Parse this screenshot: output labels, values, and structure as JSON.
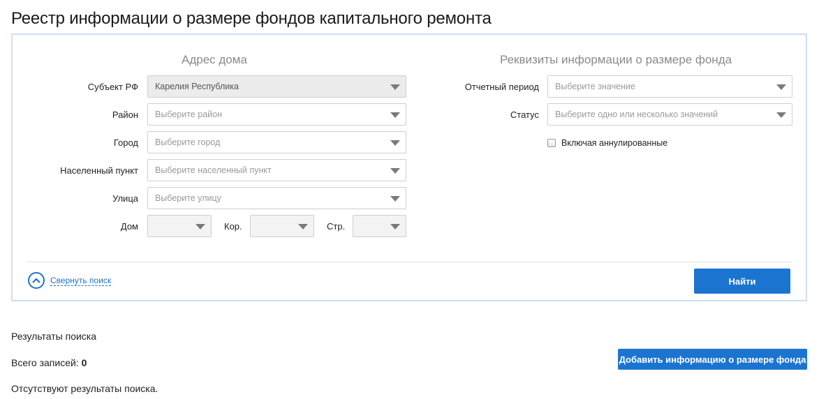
{
  "page": {
    "title": "Реестр информации о размере фондов капитального ремонта"
  },
  "address": {
    "section_title": "Адрес дома",
    "subject": {
      "label": "Субъект РФ",
      "value": "Карелия Республика"
    },
    "district": {
      "label": "Район",
      "placeholder": "Выберите район"
    },
    "city": {
      "label": "Город",
      "placeholder": "Выберите город"
    },
    "locality": {
      "label": "Населенный пункт",
      "placeholder": "Выберите населенный пункт"
    },
    "street": {
      "label": "Улица",
      "placeholder": "Выберите улицу"
    },
    "house": {
      "label": "Дом",
      "value": ""
    },
    "korpus": {
      "label": "Кор.",
      "value": ""
    },
    "building": {
      "label": "Стр.",
      "value": ""
    }
  },
  "requisites": {
    "section_title": "Реквизиты информации о размере фонда",
    "period": {
      "label": "Отчетный период",
      "placeholder": "Выберите значение"
    },
    "status": {
      "label": "Статус",
      "placeholder": "Выберите одно или несколько значений"
    },
    "include_cancelled": {
      "label": "Включая аннулированные",
      "checked": false
    }
  },
  "actions": {
    "collapse_label": "Свернуть поиск",
    "find_label": "Найти",
    "add_label": "Добавить информацию о размере фонда"
  },
  "results": {
    "title": "Результаты поиска",
    "total_label": "Всего записей: ",
    "total_value": "0",
    "empty_message": "Отсутствуют результаты поиска."
  },
  "colors": {
    "accent": "#1b75d0",
    "panel_border": "#cfe0ef"
  }
}
